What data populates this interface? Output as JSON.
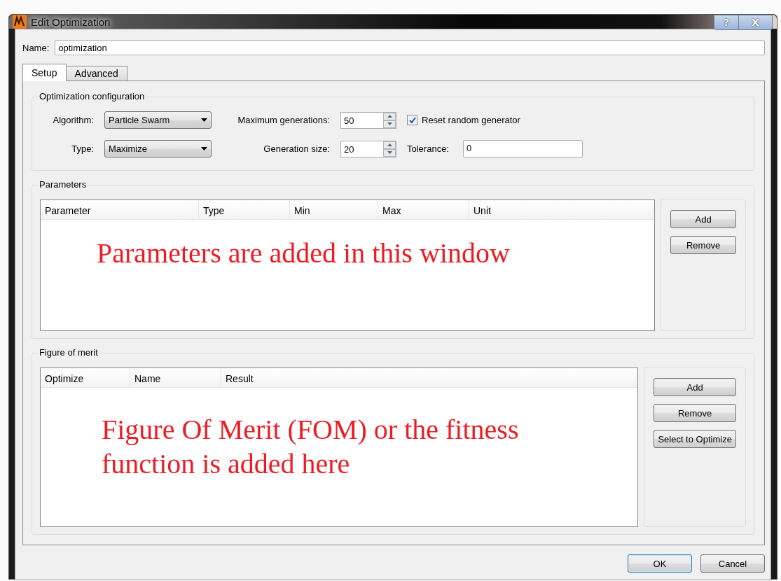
{
  "window": {
    "title": "Edit Optimization",
    "help_button": "?",
    "close_button": "X"
  },
  "name_field": {
    "label": "Name:",
    "value": "optimization"
  },
  "tabs": [
    {
      "label": "Setup",
      "selected": true
    },
    {
      "label": "Advanced",
      "selected": false
    }
  ],
  "optimization_configuration": {
    "title": "Optimization configuration",
    "algorithm": {
      "label": "Algorithm:",
      "value": "Particle Swarm"
    },
    "maximum_generations": {
      "label": "Maximum generations:",
      "value": "50"
    },
    "reset_random_generator": {
      "label": "Reset random generator",
      "checked": true
    },
    "type": {
      "label": "Type:",
      "value": "Maximize"
    },
    "generation_size": {
      "label": "Generation size:",
      "value": "20"
    },
    "tolerance": {
      "label": "Tolerance:",
      "value": "0"
    }
  },
  "parameters": {
    "title": "Parameters",
    "columns": [
      "Parameter",
      "Type",
      "Min",
      "Max",
      "Unit"
    ],
    "annotation": "Parameters are added in this window",
    "buttons": [
      "Add",
      "Remove"
    ]
  },
  "figure_of_merit": {
    "title": "Figure of merit",
    "columns": [
      "Optimize",
      "Name",
      "Result"
    ],
    "annotation": "Figure Of Merit (FOM) or the fitness function is added here",
    "buttons": [
      "Add",
      "Remove",
      "Select to Optimize"
    ]
  },
  "dialog_buttons": [
    {
      "label": "OK",
      "focused": true
    },
    {
      "label": "Cancel",
      "focused": false
    }
  ]
}
